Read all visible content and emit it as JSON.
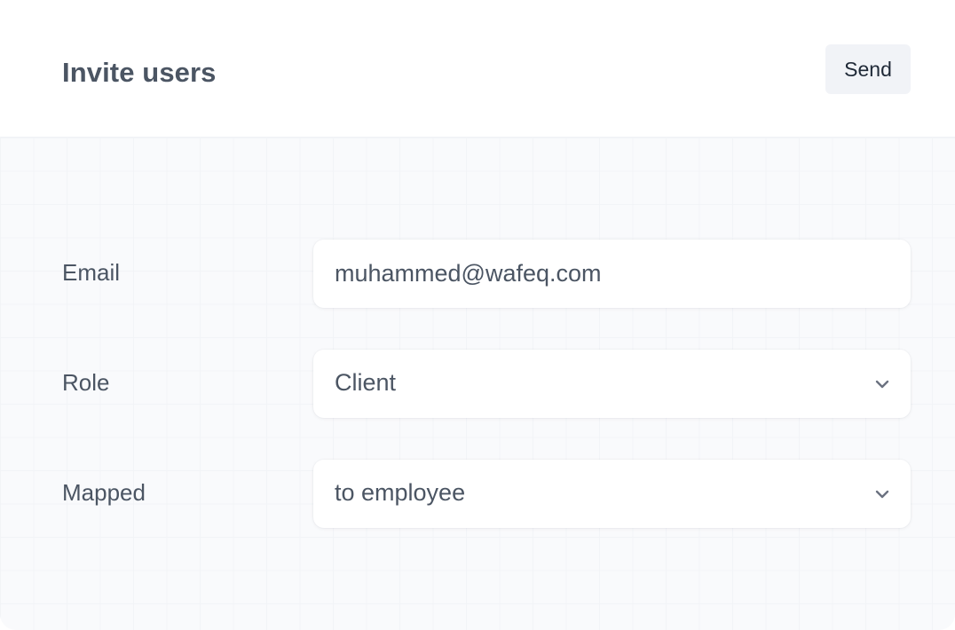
{
  "header": {
    "title": "Invite users",
    "send_label": "Send"
  },
  "form": {
    "email": {
      "label": "Email",
      "value": "muhammed@wafeq.com"
    },
    "role": {
      "label": "Role",
      "selected": "Client",
      "icon": "chevron-down-icon"
    },
    "mapped": {
      "label": "Mapped",
      "selected": "to employee",
      "icon": "chevron-down-icon"
    }
  },
  "colors": {
    "text": "#4b5563",
    "button_bg": "#f1f3f7",
    "body_bg": "#f9fafc",
    "field_bg": "#ffffff"
  }
}
